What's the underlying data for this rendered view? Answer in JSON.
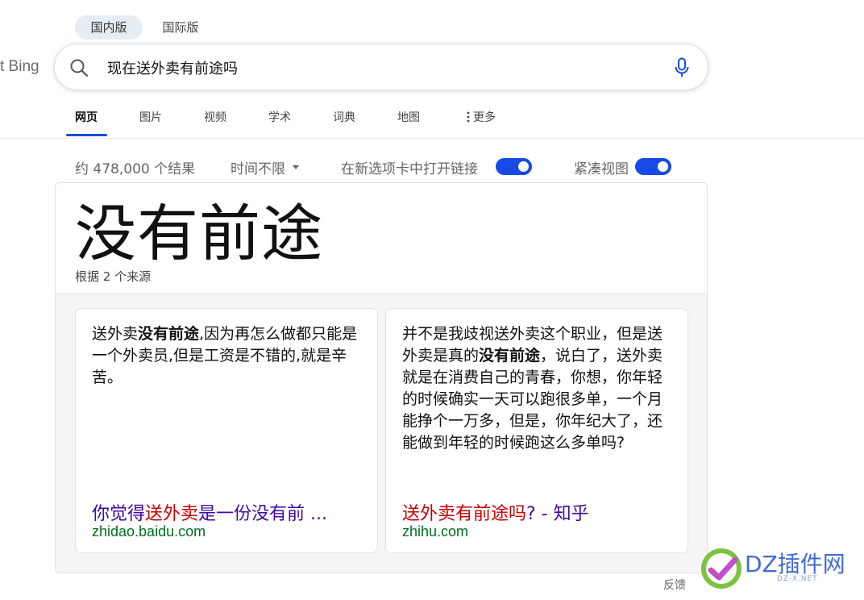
{
  "region_tabs": [
    {
      "label": "国内版",
      "active": true
    },
    {
      "label": "国际版",
      "active": false
    }
  ],
  "logo_text": "t Bing",
  "search": {
    "query": "现在送外卖有前途吗"
  },
  "nav": {
    "tabs": [
      "网页",
      "图片",
      "视频",
      "学术",
      "词典",
      "地图"
    ],
    "more": "更多",
    "active_index": 0
  },
  "filters": {
    "result_count": "约 478,000 个结果",
    "time_filter": "时间不限",
    "new_tab_label": "在新选项卡中打开链接",
    "new_tab_on": true,
    "compact_label": "紧凑视图",
    "compact_on": true
  },
  "answer": {
    "title": "没有前途",
    "subtitle": "根据 2 个来源",
    "sources": [
      {
        "body": [
          {
            "text": "送外卖",
            "bold": false
          },
          {
            "text": "没有前途",
            "bold": true
          },
          {
            "text": ",因为再怎么做都只能是一个外卖员,但是工资是不错的,就是辛苦。",
            "bold": false
          }
        ],
        "link": [
          {
            "text": "你觉得",
            "highlight": false
          },
          {
            "text": "送外卖",
            "highlight": true
          },
          {
            "text": "是一份没有前 ...",
            "highlight": false
          }
        ],
        "domain": "zhidao.baidu.com"
      },
      {
        "body": [
          {
            "text": "并不是我歧视送外卖这个职业，但是送外卖是真的",
            "bold": false
          },
          {
            "text": "没有前途",
            "bold": true
          },
          {
            "text": "，说白了，送外卖就是在消费自己的青春，你想，你年轻的时候确实一天可以跑很多单，一个月能挣个一万多，但是，你年纪大了，还能做到年轻的时候跑这么多单吗?",
            "bold": false
          }
        ],
        "link": [
          {
            "text": "送外卖有前途吗",
            "highlight": true
          },
          {
            "text": "? - 知乎",
            "highlight": false
          }
        ],
        "domain": "zhihu.com"
      }
    ]
  },
  "feedback_label": "反馈",
  "watermark": {
    "text": "DZ插件网",
    "sub": "DZ-X.NET"
  },
  "colors": {
    "accent": "#174ae4",
    "link": "#4007a2",
    "highlight": "#c80000",
    "domain": "#006d21"
  }
}
